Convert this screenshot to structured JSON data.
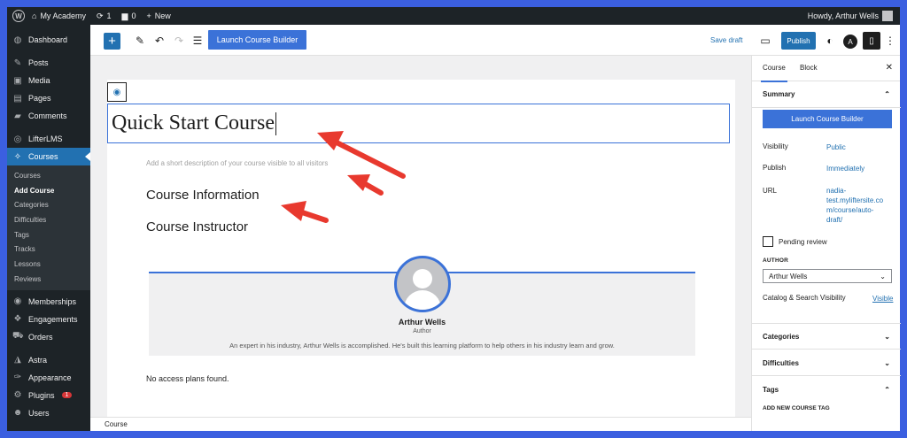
{
  "admin_bar": {
    "site_name": "My Academy",
    "updates_count": "1",
    "comments_count": "0",
    "new_label": "New",
    "howdy": "Howdy, Arthur Wells"
  },
  "sidebar": {
    "items_top": [
      {
        "label": "Dashboard",
        "icon": "dashboard-icon",
        "glyph": "◍"
      }
    ],
    "items_mid": [
      {
        "label": "Posts",
        "icon": "pin-icon",
        "glyph": "✎"
      },
      {
        "label": "Media",
        "icon": "media-icon",
        "glyph": "▣"
      },
      {
        "label": "Pages",
        "icon": "pages-icon",
        "glyph": "▤"
      },
      {
        "label": "Comments",
        "icon": "comments-icon",
        "glyph": "▰"
      }
    ],
    "lifter": {
      "label": "LifterLMS",
      "icon": "lifterlms-icon",
      "glyph": "◎"
    },
    "courses": {
      "label": "Courses",
      "icon": "graduation-cap-icon",
      "glyph": "✧"
    },
    "courses_sub": [
      {
        "label": "Courses"
      },
      {
        "label": "Add Course"
      },
      {
        "label": "Categories"
      },
      {
        "label": "Difficulties"
      },
      {
        "label": "Tags"
      },
      {
        "label": "Tracks"
      },
      {
        "label": "Lessons"
      },
      {
        "label": "Reviews"
      }
    ],
    "items_bottom": [
      {
        "label": "Memberships",
        "icon": "memberships-icon",
        "glyph": "◉"
      },
      {
        "label": "Engagements",
        "icon": "engagements-icon",
        "glyph": "❖"
      },
      {
        "label": "Orders",
        "icon": "cart-icon",
        "glyph": "⛟"
      }
    ],
    "items_bottom2": [
      {
        "label": "Astra",
        "icon": "astra-icon",
        "glyph": "◮"
      },
      {
        "label": "Appearance",
        "icon": "appearance-icon",
        "glyph": "✑"
      },
      {
        "label": "Plugins",
        "icon": "plugins-icon",
        "glyph": "⚙",
        "badge": "1"
      },
      {
        "label": "Users",
        "icon": "users-icon",
        "glyph": "☻"
      }
    ]
  },
  "toolbar": {
    "launch_label": "Launch Course Builder",
    "save_draft": "Save draft",
    "publish": "Publish"
  },
  "editor": {
    "title": "Quick Start Course",
    "description_placeholder": "Add a short description of your course visible to all visitors",
    "heading_info": "Course Information",
    "heading_instructor": "Course Instructor",
    "instructor_name": "Arthur Wells",
    "instructor_role": "Author",
    "instructor_bio": "An expert in his industry, Arthur Wells is accomplished. He's built this learning platform to help others in his industry learn and grow.",
    "no_access": "No access plans found.",
    "footer_breadcrumb": "Course"
  },
  "settings": {
    "tab_course": "Course",
    "tab_block": "Block",
    "summary_title": "Summary",
    "launch_label": "Launch Course Builder",
    "visibility_label": "Visibility",
    "visibility_value": "Public",
    "publish_label": "Publish",
    "publish_value": "Immediately",
    "url_label": "URL",
    "url_line1": "nadia-",
    "url_line2": "test.myliftersite.co",
    "url_line3": "m/course/auto-",
    "url_line4": "draft/",
    "pending_review": "Pending review",
    "author_label": "AUTHOR",
    "author_value": "Arthur Wells",
    "catalog_label": "Catalog & Search Visibility",
    "catalog_value": "Visible",
    "categories_title": "Categories",
    "difficulties_title": "Difficulties",
    "tags_title": "Tags",
    "add_tag_label": "ADD NEW COURSE TAG"
  },
  "colors": {
    "accent": "#3b72d8",
    "admin_dark": "#1d2327",
    "wp_blue": "#2271b1",
    "arrow_red": "#e8392e",
    "outer_border": "#3b5fe0"
  }
}
